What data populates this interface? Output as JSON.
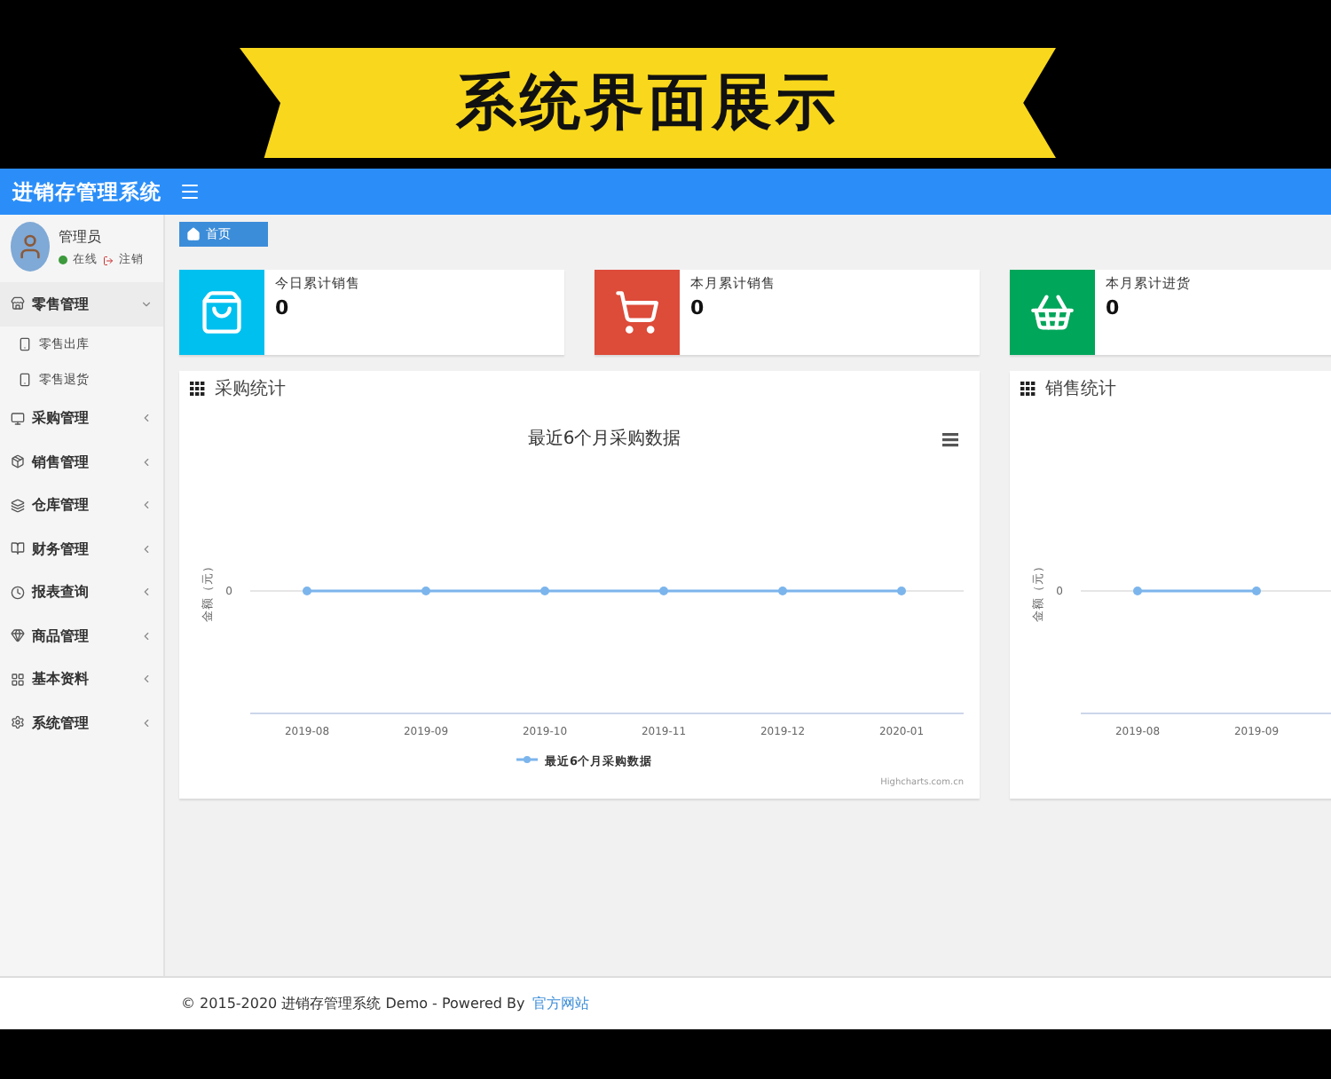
{
  "banner": {
    "title": "系统界面展示"
  },
  "header": {
    "app_name": "进销存管理系统"
  },
  "user": {
    "name": "管理员",
    "status": "在线",
    "logout": "注销"
  },
  "sidebar": {
    "items": [
      {
        "label": "零售管理",
        "expanded": true,
        "children": [
          {
            "label": "零售出库"
          },
          {
            "label": "零售退货"
          }
        ]
      },
      {
        "label": "采购管理",
        "expanded": false
      },
      {
        "label": "销售管理",
        "expanded": false
      },
      {
        "label": "仓库管理",
        "expanded": false
      },
      {
        "label": "财务管理",
        "expanded": false
      },
      {
        "label": "报表查询",
        "expanded": false
      },
      {
        "label": "商品管理",
        "expanded": false
      },
      {
        "label": "基本资料",
        "expanded": false
      },
      {
        "label": "系统管理",
        "expanded": false
      }
    ]
  },
  "breadcrumb": {
    "label": "首页"
  },
  "stats": [
    {
      "label": "今日累计销售",
      "value": "0",
      "color": "#00c0ef"
    },
    {
      "label": "本月累计销售",
      "value": "0",
      "color": "#dd4b39"
    },
    {
      "label": "本月累计进货",
      "value": "0",
      "color": "#00a65a"
    }
  ],
  "charts": [
    {
      "title": "采购统计",
      "chart_title": "最近6个月采购数据",
      "y_axis_title": "金额（元）",
      "y_tick_label": "0",
      "x_labels": [
        "2019-08",
        "2019-09",
        "2019-10",
        "2019-11",
        "2019-12",
        "2020-01"
      ],
      "legend": "最近6个月采购数据",
      "credit": "Highcharts.com.cn"
    },
    {
      "title": "销售统计",
      "y_axis_title": "金额（元）",
      "y_tick_label": "0",
      "x_labels": [
        "2019-08",
        "2019-09"
      ]
    }
  ],
  "footer": {
    "text": "© 2015-2020 进销存管理系统 Demo - Powered By",
    "link": "官方网站"
  }
}
